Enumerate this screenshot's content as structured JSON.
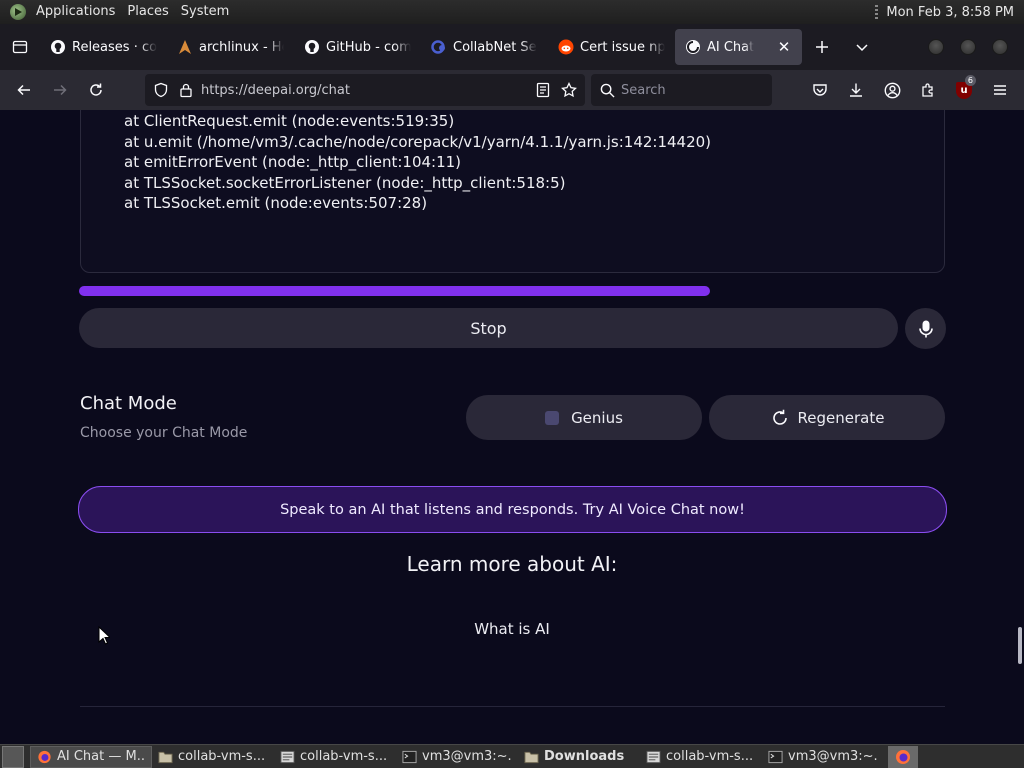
{
  "top_panel": {
    "menus": [
      "Applications",
      "Places",
      "System"
    ],
    "clock": "Mon Feb  3,  8:58 PM"
  },
  "browser": {
    "tabs": [
      {
        "title": "Releases · co",
        "icon": "github-icon",
        "active": false
      },
      {
        "title": "archlinux - He",
        "icon": "archlinux-icon",
        "active": false
      },
      {
        "title": "GitHub - com",
        "icon": "github-icon",
        "active": false
      },
      {
        "title": "CollabNet Se",
        "icon": "collabnet-icon",
        "active": false
      },
      {
        "title": "Cert issue np",
        "icon": "reddit-icon",
        "active": false
      },
      {
        "title": "AI Chat",
        "icon": "deepai-icon",
        "active": true
      }
    ],
    "url": "https://deepai.org/chat",
    "search_placeholder": "Search",
    "extension_badge": "6",
    "ublock_label": "u"
  },
  "page": {
    "stack_trace": [
      "at ClientRequest.emit (node:events:519:35)",
      "at u.emit (/home/vm3/.cache/node/corepack/v1/yarn/4.1.1/yarn.js:142:14420)",
      "at emitErrorEvent (node:_http_client:104:11)",
      "at TLSSocket.socketErrorListener (node:_http_client:518:5)",
      "at TLSSocket.emit (node:events:507:28)"
    ],
    "stop_label": "Stop",
    "chat_mode_title": "Chat Mode",
    "chat_mode_subtitle": "Choose your Chat Mode",
    "genius_label": "Genius",
    "regenerate_label": "Regenerate",
    "voice_banner": "Speak to an AI that listens and responds. Try AI Voice Chat now!",
    "learn_heading": "Learn more about AI:",
    "what_is_ai": "What is AI",
    "accent_color": "#8030ee"
  },
  "taskbar": {
    "tasks": [
      {
        "label": "AI Chat — M...",
        "icon": "firefox-icon",
        "active": true
      },
      {
        "label": "collab-vm-s...",
        "icon": "folder-icon",
        "active": false
      },
      {
        "label": "collab-vm-s...",
        "icon": "editor-icon",
        "active": false
      },
      {
        "label": "vm3@vm3:~...",
        "icon": "terminal-icon",
        "active": false
      },
      {
        "label": "Downloads",
        "icon": "folder-icon",
        "active": false,
        "bold": true
      },
      {
        "label": "collab-vm-s...",
        "icon": "editor-icon",
        "active": false
      },
      {
        "label": "vm3@vm3:~...",
        "icon": "terminal-icon",
        "active": false
      }
    ]
  }
}
